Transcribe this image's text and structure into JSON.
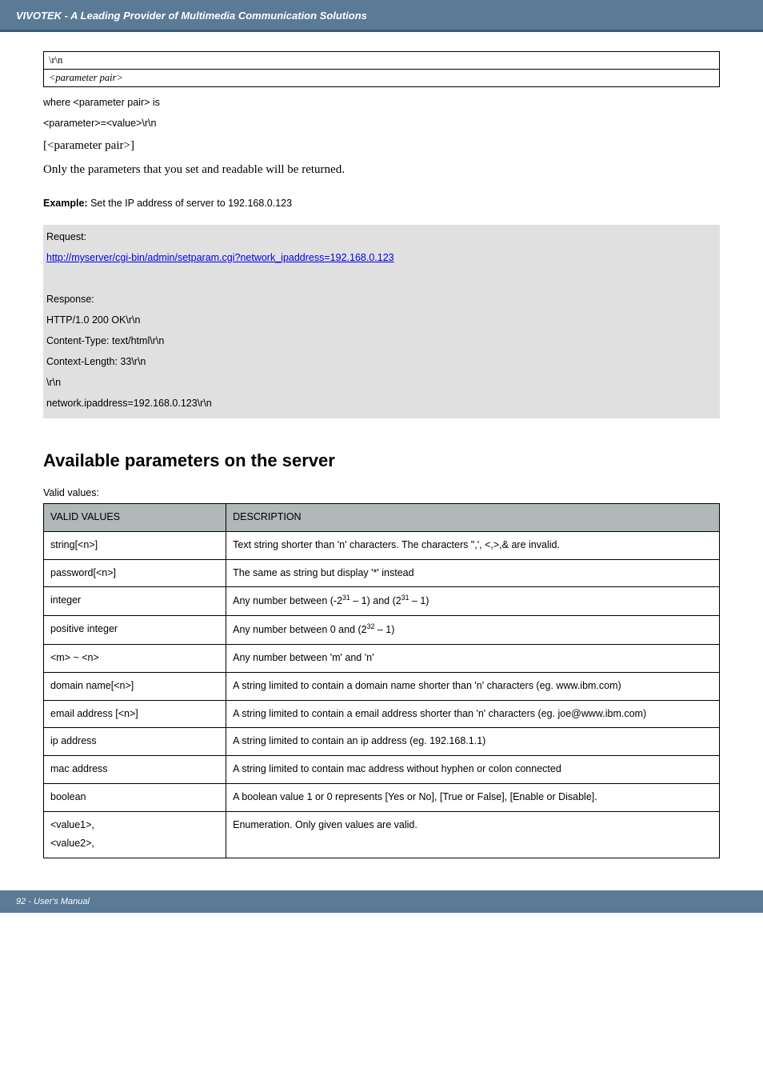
{
  "header": {
    "title": "VIVOTEK - A Leading Provider of Multimedia Communication Solutions"
  },
  "param_box": {
    "row1": "\\r\\n",
    "row2": "<parameter pair>"
  },
  "body_lines": {
    "l1": "where <parameter pair> is",
    "l2": "<parameter>=<value>\\r\\n",
    "l3": "[<parameter pair>]",
    "l4": "Only the parameters that you set and readable will be returned."
  },
  "example_intro_bold": "Example:",
  "example_intro_rest": " Set the IP address of server to 192.168.0.123",
  "example": {
    "l1": "Request:",
    "link": "http://myserver/cgi-bin/admin/setparam.cgi?network_ipaddress=192.168.0.123",
    "l3": "Response:",
    "l4": "HTTP/1.0 200 OK\\r\\n",
    "l5": "Content-Type: text/html\\r\\n",
    "l6": "Context-Length: 33\\r\\n",
    "l7": "\\r\\n",
    "l8": "network.ipaddress=192.168.0.123\\r\\n"
  },
  "section_title": "Available parameters on the server",
  "valid_values_label": "Valid values:",
  "table": {
    "headers": {
      "c1": "VALID VALUES",
      "c2": "DESCRIPTION"
    },
    "rows": [
      {
        "c1": "string[<n>]",
        "c2": "Text string shorter than 'n' characters. The characters \",', <,>,& are invalid."
      },
      {
        "c1": "password[<n>]",
        "c2": "The same as string but display '*' instead"
      },
      {
        "c1": "integer",
        "c2_html": "Any number between (-2<sup>31</sup> – 1) and (2<sup>31</sup> – 1)"
      },
      {
        "c1": "positive integer",
        "c2_html": "Any number between 0 and (2<sup>32</sup> – 1)"
      },
      {
        "c1": "<m> ~ <n>",
        "c2": "Any number between 'm' and 'n'"
      },
      {
        "c1": "domain name[<n>]",
        "c2": "A string limited to contain a domain name shorter than 'n' characters (eg. www.ibm.com)"
      },
      {
        "c1": "email address [<n>]",
        "c2": "A string limited to contain a email address shorter than 'n' characters (eg. joe@www.ibm.com)"
      },
      {
        "c1": "ip address",
        "c2": "A string limited to contain an ip address (eg. 192.168.1.1)"
      },
      {
        "c1": "mac address",
        "c2": "A string limited to contain mac address without hyphen or colon connected"
      },
      {
        "c1": "boolean",
        "c2": "A boolean value 1 or 0 represents [Yes or No], [True or False], [Enable or Disable]."
      },
      {
        "c1_html": "&lt;value1&gt;,<br>&lt;value2&gt;,",
        "c2": "Enumeration. Only given values are valid."
      }
    ]
  },
  "footer": {
    "text": "92 - User's Manual"
  }
}
